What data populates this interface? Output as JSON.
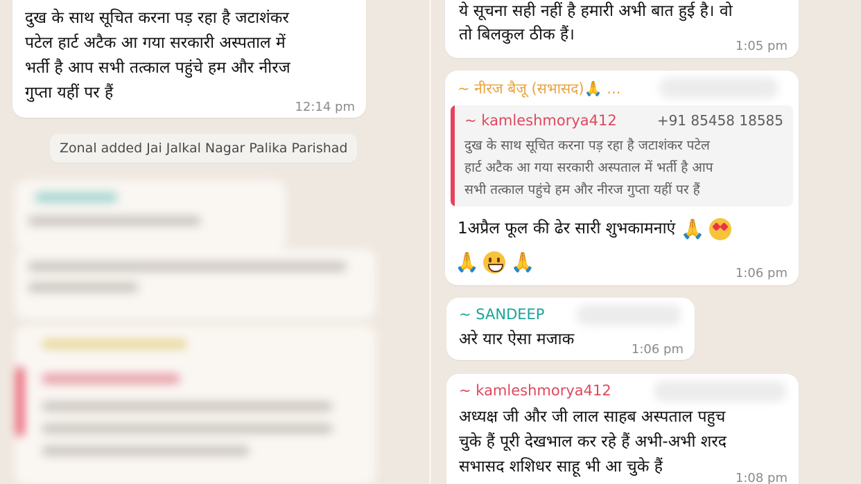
{
  "left": {
    "message1": {
      "lines": [
        "दुख के साथ सूचित करना पड़ रहा है जटाशंकर",
        "पटेल हार्ट अटैक आ गया सरकारी अस्पताल में",
        "भर्ती है आप सभी तत्काल पहुंचे हम और नीरज",
        "गुप्ता यहीं पर हैं"
      ],
      "time": "12:14 pm"
    },
    "system_notice": "Zonal added Jai Jalkal Nagar Palika Parishad"
  },
  "right": {
    "message1": {
      "lines": [
        "ये सूचना सही नहीं है हमारी अभी बात हुई है। वो",
        "तो बिलकुल ठीक हैं।"
      ],
      "time": "1:05 pm"
    },
    "message2": {
      "sender": "~ नीरज बैजू (सभासद)🙏 ...",
      "quote": {
        "sender": "~ kamleshmorya412",
        "phone": "+91 85458 18585",
        "lines": [
          "दुख के साथ सूचित करना पड़ रहा है जटाशंकर पटेल",
          "हार्ट अटैक आ गया सरकारी अस्पताल में भर्ती है आप",
          "सभी तत्काल पहुंचे हम और नीरज गुप्ता यहीं पर हैं"
        ]
      },
      "text": "1अप्रैल फूल की ढेर सारी शुभकामनाएं",
      "emojis_line1": [
        "folded-hands",
        "heart-eyes"
      ],
      "emojis_line2": [
        "folded-hands",
        "grinning",
        "folded-hands"
      ],
      "time": "1:06 pm"
    },
    "message3": {
      "sender": "~ SANDEEP",
      "text": "अरे यार ऐसा मजाक",
      "time": "1:06 pm"
    },
    "message4": {
      "sender": "~ kamleshmorya412",
      "lines": [
        "अध्यक्ष जी और जी लाल साहब अस्पताल पहुच",
        "चुके हैं पूरी देखभाल कर रहे हैं अभी-अभी शरद",
        "सभासद शशिधर साहू भी आ चुके हैं"
      ],
      "time": "1:08 pm"
    }
  },
  "colors": {
    "background": "#efe8e0",
    "bubble": "#ffffff",
    "sender_orange": "#e8a33d",
    "sender_red": "#e0475d",
    "sender_teal": "#1aa39a",
    "quote_bar": "#e8415b"
  }
}
